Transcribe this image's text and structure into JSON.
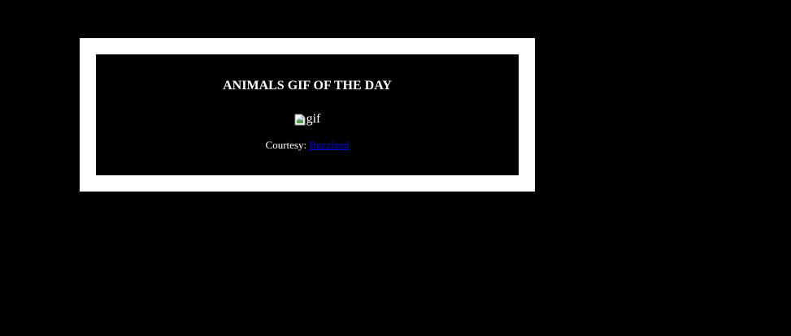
{
  "card": {
    "title": "ANIMALS GIF OF THE DAY",
    "gif_alt": "gif",
    "courtesy_label": "Courtesy:",
    "source_link": "Buzzfeed"
  },
  "colors": {
    "background": "#000000",
    "frame": "#ffffff",
    "text": "#ffffff",
    "link": "#0000ee"
  }
}
